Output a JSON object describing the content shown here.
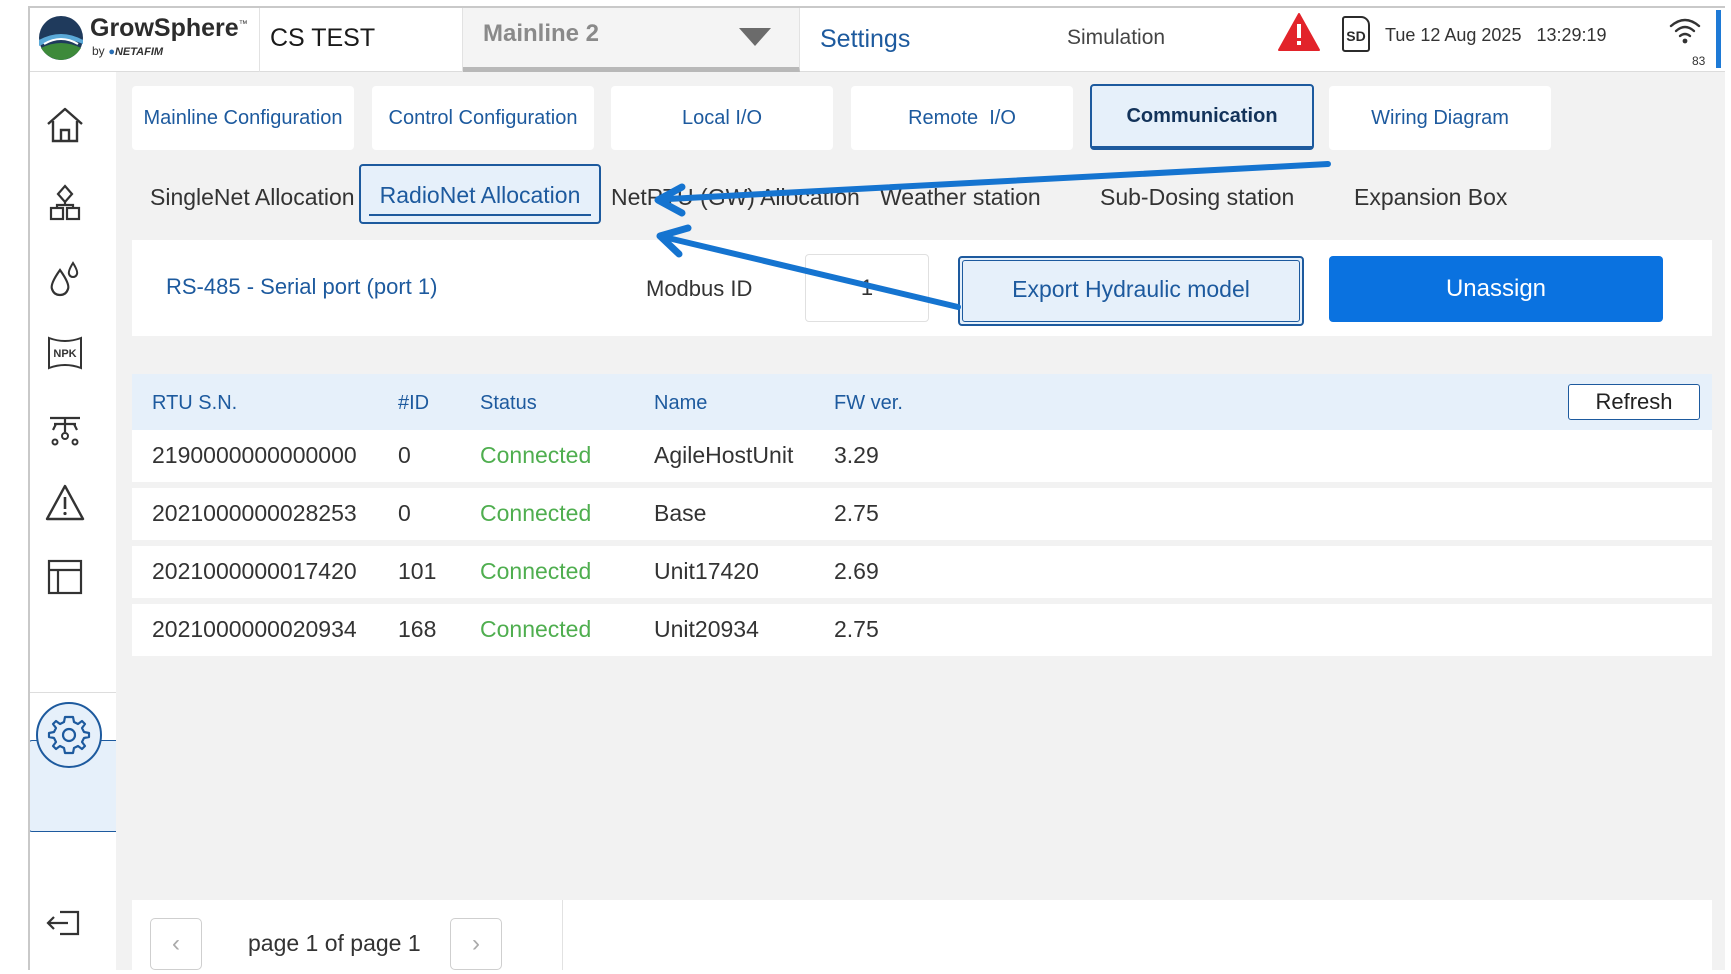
{
  "header": {
    "brand_name": "GrowSphere",
    "brand_tm": "™",
    "brand_by": "by",
    "brand_maker": "NETAFIM",
    "site_name": "CS TEST",
    "mainline_selected": "Mainline 2",
    "section_title": "Settings",
    "mode": "Simulation",
    "sd_label": "SD",
    "date": "Tue 12 Aug 2025",
    "time": "13:29:19",
    "wifi_strength": "83",
    "colors": {
      "accent": "#1d5a9e",
      "primary_button": "#0a72e0",
      "alert": "#e2232a",
      "connected": "#4fae4f"
    }
  },
  "sidebar": {
    "items": [
      {
        "icon": "home-icon"
      },
      {
        "icon": "network-icon"
      },
      {
        "icon": "water-drops-icon"
      },
      {
        "icon": "npk-icon",
        "label": "NPK"
      },
      {
        "icon": "irrigation-icon"
      },
      {
        "icon": "warning-icon"
      },
      {
        "icon": "table-icon"
      },
      {
        "icon": "gear-icon",
        "active": true
      },
      {
        "icon": "logout-icon"
      }
    ]
  },
  "main_tabs": [
    {
      "label": "Mainline Configuration"
    },
    {
      "label": "Control Configuration"
    },
    {
      "label": "Local I/O"
    },
    {
      "label": "Remote  I/O"
    },
    {
      "label": "Communication",
      "active": true
    },
    {
      "label": "Wiring Diagram"
    }
  ],
  "sub_tabs": [
    {
      "label": "SingleNet Allocation"
    },
    {
      "label": "RadioNet Allocation",
      "active": true
    },
    {
      "label": "NetRTU (GW) Allocation"
    },
    {
      "label": "Weather station"
    },
    {
      "label": "Sub-Dosing station"
    },
    {
      "label": "Expansion Box"
    }
  ],
  "port": {
    "label": "RS-485 - Serial port (port 1)",
    "modbus_label": "Modbus ID",
    "modbus_value": "1",
    "export_label": "Export Hydraulic model",
    "unassign_label": "Unassign"
  },
  "table": {
    "headers": [
      "RTU S.N.",
      "#ID",
      "Status",
      "Name",
      "FW ver."
    ],
    "refresh_label": "Refresh",
    "rows": [
      {
        "sn": "2190000000000000",
        "id": "0",
        "status": "Connected",
        "name": "AgileHostUnit",
        "fw": "3.29"
      },
      {
        "sn": "2021000000028253",
        "id": "0",
        "status": "Connected",
        "name": "Base",
        "fw": "2.75"
      },
      {
        "sn": "2021000000017420",
        "id": "101",
        "status": "Connected",
        "name": "Unit17420",
        "fw": "2.69"
      },
      {
        "sn": "2021000000020934",
        "id": "168",
        "status": "Connected",
        "name": "Unit20934",
        "fw": "2.75"
      }
    ]
  },
  "pagination": {
    "prev": "‹",
    "next": "›",
    "text": "page 1 of page 1"
  }
}
